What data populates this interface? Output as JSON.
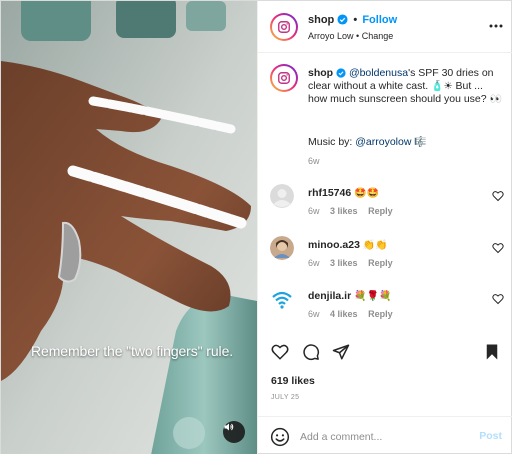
{
  "media": {
    "caption": "Remember the \"two fingers\" rule."
  },
  "header": {
    "username": "shop",
    "separator": "•",
    "follow_label": "Follow",
    "audio_artist": "Arroyo Low",
    "audio_separator": "•",
    "audio_action": "Change"
  },
  "post": {
    "username": "shop",
    "mention": "@boldenusa",
    "text_after_mention": "'s SPF 30 dries on clear without a white cast.",
    "text_emojis": "🧴☀",
    "text_tail": "But ... how much sunscreen should you use?",
    "text_tail_emojis": "👀",
    "music_prefix": "Music by: ",
    "music_artist": "@arroyolow",
    "music_emoji": "🎼",
    "time": "6w"
  },
  "comments": [
    {
      "username": "rhf15746",
      "text": "🤩🤩",
      "time": "6w",
      "likes": "3 likes",
      "reply": "Reply"
    },
    {
      "username": "minoo.a23",
      "text": "👏👏",
      "time": "6w",
      "likes": "3 likes",
      "reply": "Reply"
    },
    {
      "username": "denjila.ir",
      "text": "💐🌹💐",
      "time": "6w",
      "likes": "4 likes",
      "reply": "Reply"
    }
  ],
  "stats": {
    "likes": "619 likes",
    "date": "JULY 25"
  },
  "composer": {
    "placeholder": "Add a comment...",
    "post_label": "Post"
  },
  "colors": {
    "accent": "#0095f6",
    "post_disabled": "#b2dffc",
    "muted": "#8e8e8e"
  }
}
